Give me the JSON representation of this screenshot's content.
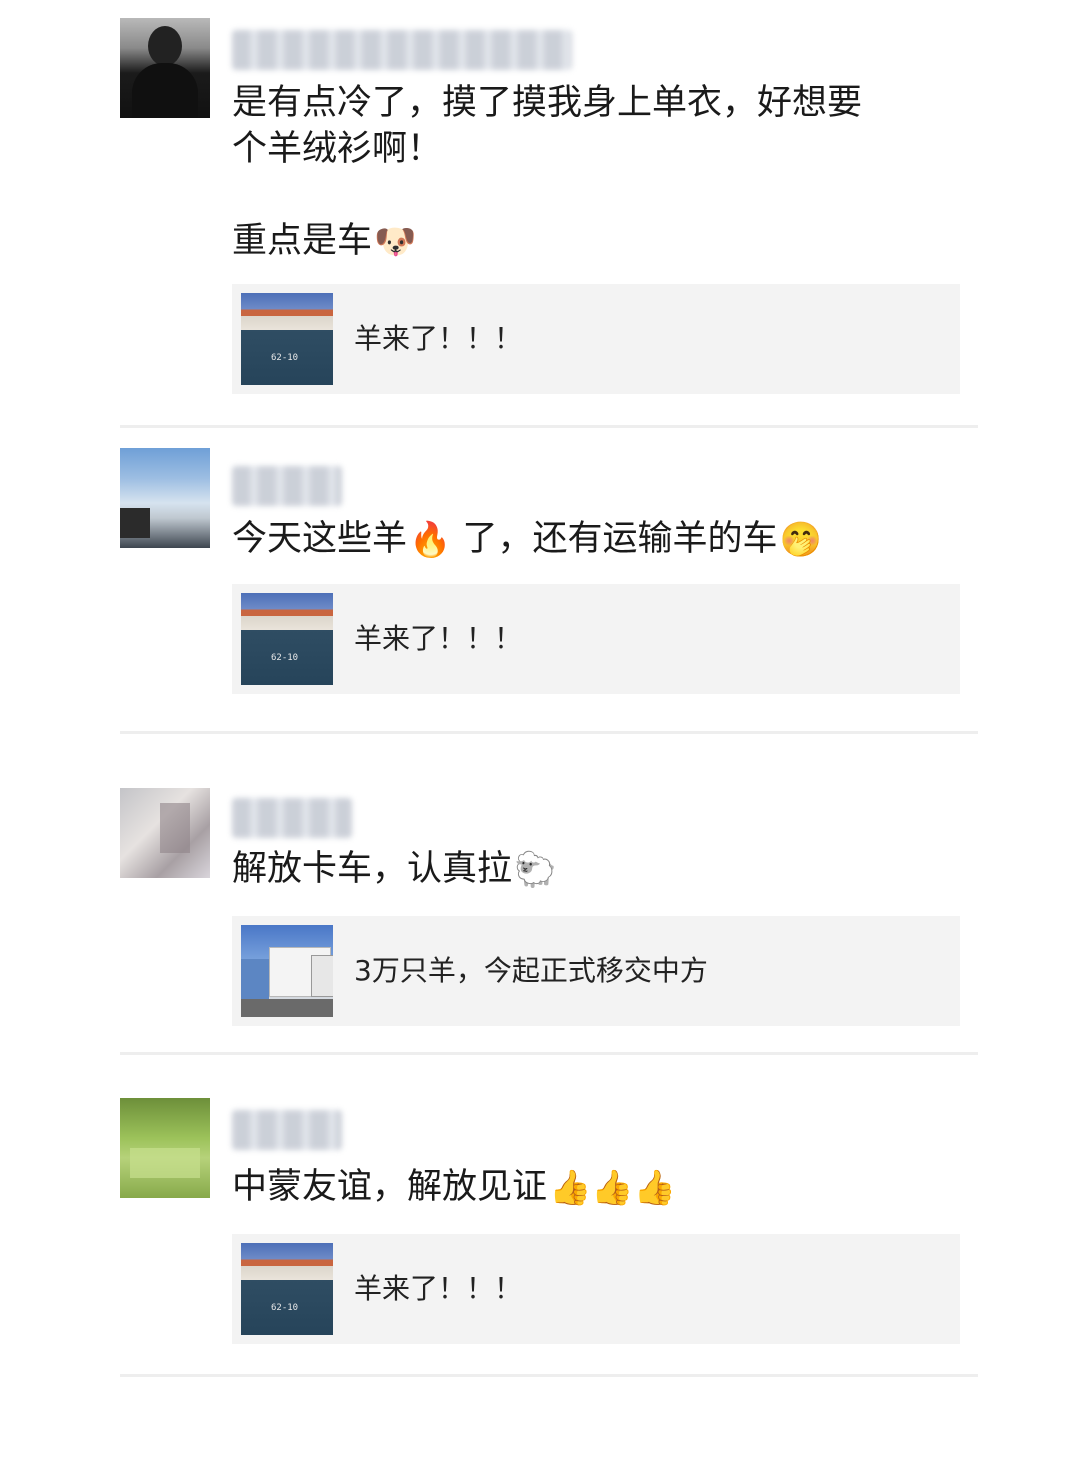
{
  "posts": [
    {
      "text_line1": "是有点冷了，摸了摸我身上单衣，好想要",
      "text_line2": "个羊绒衫啊！",
      "text_line3": "重点是车",
      "emoji": "🐶",
      "emoji_icon": "dog-face-icon",
      "link_title": "羊来了！！！"
    },
    {
      "text_part1": "今天这些羊",
      "emoji1": "🔥",
      "emoji1_icon": "fire-icon",
      "text_part2": "了，还有运输羊的车",
      "emoji2": "🤭",
      "emoji2_icon": "hand-over-mouth-icon",
      "link_title": "羊来了！！！"
    },
    {
      "text": "解放卡车，认真拉",
      "emoji": "🐑",
      "emoji_icon": "sheep-icon",
      "link_title": "3万只羊，今起正式移交中方"
    },
    {
      "text": "中蒙友谊，解放见证",
      "emoji": "👍👍👍",
      "emoji_icon": "thumbs-up-icon",
      "link_title": "羊来了！！！"
    }
  ]
}
